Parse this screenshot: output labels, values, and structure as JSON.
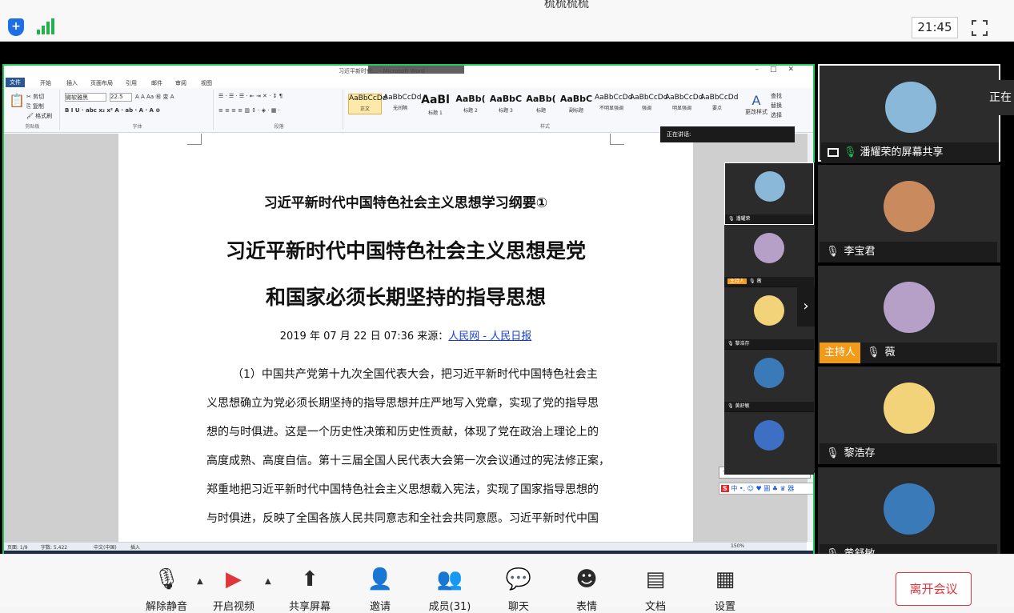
{
  "topbar": {
    "clock": "21:45",
    "cut_text": "梳梳梳梳"
  },
  "word": {
    "title": "习近平新时代... - Microsoft Word",
    "tabs": [
      "文件",
      "开始",
      "插入",
      "页面布局",
      "引用",
      "邮件",
      "审阅",
      "视图"
    ],
    "font_name": "微软雅黑",
    "font_size": "22.5",
    "groups": [
      "剪贴板",
      "字体",
      "段落",
      "样式"
    ],
    "styles": [
      {
        "sample": "AaBbCcDd",
        "name": "正文"
      },
      {
        "sample": "AaBbCcDd",
        "name": "无间隔"
      },
      {
        "sample": "AaBl",
        "name": "标题 1"
      },
      {
        "sample": "AaBb(",
        "name": "标题 2"
      },
      {
        "sample": "AaBbC",
        "name": "标题 3"
      },
      {
        "sample": "AaBb(",
        "name": "标题"
      },
      {
        "sample": "AaBbC",
        "name": "副标题"
      },
      {
        "sample": "AaBbCcDd",
        "name": "不明显强调"
      },
      {
        "sample": "AaBbCcDd",
        "name": "强调"
      },
      {
        "sample": "AaBbCcDd",
        "name": "明显强调"
      },
      {
        "sample": "AaBbCcDd",
        "name": "要点"
      }
    ],
    "change_styles": "更改样式",
    "edit_tools": [
      "查找",
      "替换",
      "选择"
    ],
    "doc": {
      "subtitle": "习近平新时代中国特色社会主义思想学习纲要①",
      "title_line1": "习近平新时代中国特色社会主义思想是党",
      "title_line2": "和国家必须长期坚持的指导思想",
      "date": "2019 年 07 月 22 日 07:36  来源：",
      "source": "人民网 - 人民日报",
      "paragraph_lines": [
        "（1）中国共产党第十九次全国代表大会，把习近平新时代中国特色社会主",
        "义思想确立为党必须长期坚持的指导思想并庄严地写入党章，实现了党的指导思",
        "想的与时俱进。这是一个历史性决策和历史性贡献，体现了党在政治上理论上的",
        "高度成熟、高度自信。第十三届全国人民代表大会第一次会议通过的宪法修正案，",
        "郑重地把习近平新时代中国特色社会主义思想载入宪法，实现了国家指导思想的",
        "与时俱进，反映了全国各族人民共同意志和全社会共同意愿。习近平新时代中国"
      ]
    },
    "status": {
      "page": "页面: 1/9",
      "words": "字数: 5,422",
      "lang": "中文(中国)",
      "mode": "插入",
      "zoom": "150%"
    }
  },
  "speaking_label": "正在讲话:",
  "mini_tiles": [
    {
      "name": "潘耀荣",
      "host": false
    },
    {
      "name": "薇",
      "host": true
    },
    {
      "name": "黎浩存",
      "host": false
    },
    {
      "name": "黄舒敏",
      "host": false
    },
    {
      "name": "",
      "host": false
    }
  ],
  "host_label": "主持人",
  "ime": {
    "tip": "个性设置，点我看看",
    "bar": "中 •, ☺ ♥ 圖 ♣ ♛ 器"
  },
  "participants": [
    {
      "name": "潘耀荣的屏幕共享",
      "mic": "on",
      "screen": true,
      "host": false,
      "avatar": "#8ab8d8"
    },
    {
      "name": "李宝君",
      "mic": "off",
      "screen": false,
      "host": false,
      "avatar": "#c98a5e"
    },
    {
      "name": "薇",
      "mic": "off",
      "screen": false,
      "host": true,
      "avatar": "#b7a0c8"
    },
    {
      "name": "黎浩存",
      "mic": "off",
      "screen": false,
      "host": false,
      "avatar": "#f3d37a"
    },
    {
      "name": "黄舒敏",
      "mic": "off",
      "screen": false,
      "host": false,
      "avatar": "#3a7ab8"
    }
  ],
  "side_note": "正在",
  "toolbar": {
    "unmute": "解除静音",
    "start_video": "开启视频",
    "share_screen": "共享屏幕",
    "invite": "邀请",
    "members": "成员(31)",
    "chat": "聊天",
    "reactions": "表情",
    "docs": "文档",
    "settings": "设置",
    "leave": "离开会议"
  }
}
